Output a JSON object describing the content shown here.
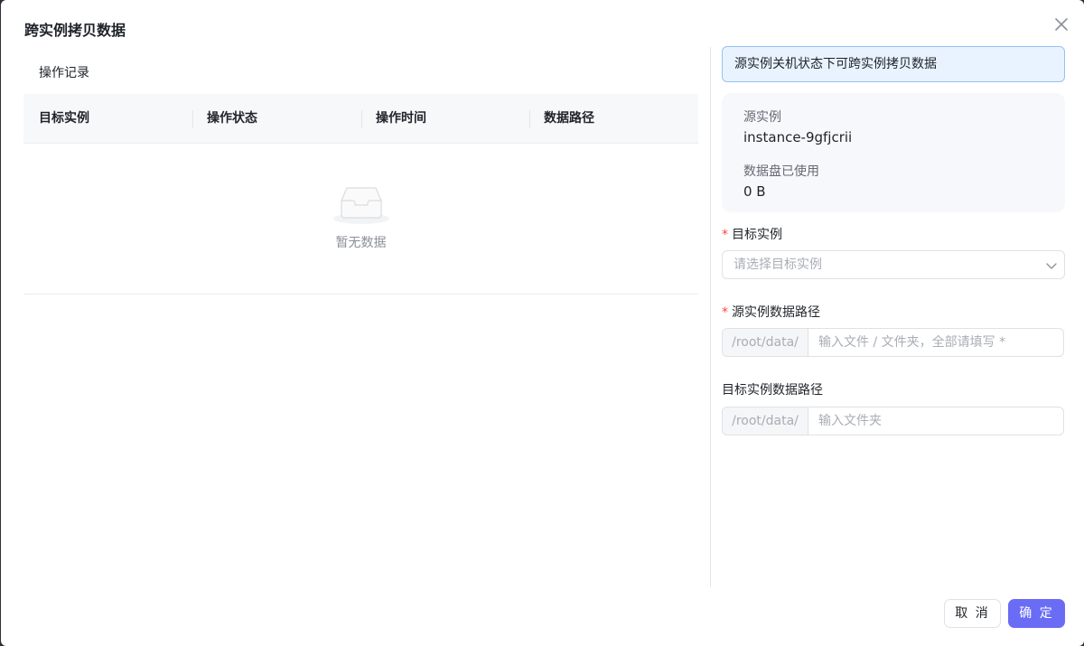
{
  "dialog": {
    "title": "跨实例拷贝数据"
  },
  "records": {
    "section_title": "操作记录",
    "columns": [
      "目标实例",
      "操作状态",
      "操作时间",
      "数据路径"
    ],
    "empty_text": "暂无数据"
  },
  "info": {
    "banner": "源实例关机状态下可跨实例拷贝数据",
    "source_label": "源实例",
    "source_value": "instance-9gfjcrii",
    "disk_label": "数据盘已使用",
    "disk_value": "0 B"
  },
  "form": {
    "required_mark": "*",
    "target_label": "目标实例",
    "target_placeholder": "请选择目标实例",
    "source_path_label": "源实例数据路径",
    "source_path_prefix": "/root/data/",
    "source_path_placeholder": "输入文件 / 文件夹，全部请填写 *",
    "target_path_label": "目标实例数据路径",
    "target_path_prefix": "/root/data/",
    "target_path_placeholder": "输入文件夹"
  },
  "footer": {
    "cancel_label": "取 消",
    "ok_label": "确 定"
  },
  "colors": {
    "primary": "#6a6cf6",
    "info_bg": "#e8f3ff",
    "required": "#f54a45"
  },
  "icons": {
    "close": "close-icon",
    "empty": "empty-inbox-icon",
    "select": "chevron-down-icon"
  }
}
